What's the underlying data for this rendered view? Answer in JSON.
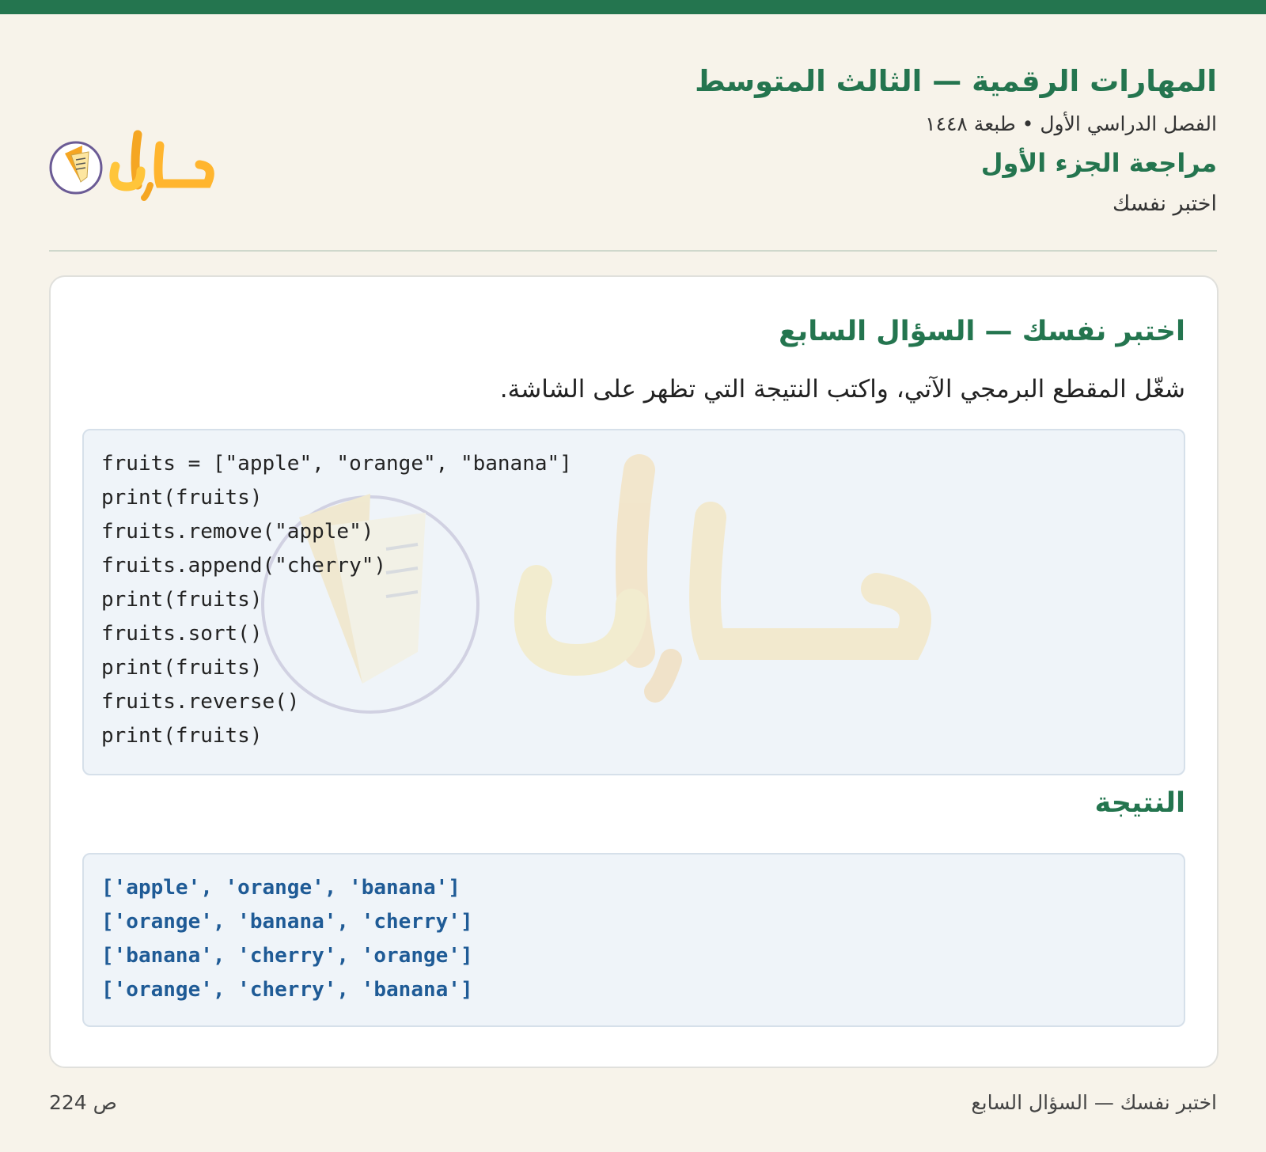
{
  "header": {
    "title": "المهارات الرقمية — الثالث المتوسط",
    "subtitle": "الفصل الدراسي الأول • طبعة ١٤٤٨",
    "section_title": "مراجعة الجزء الأول",
    "section_sub": "اختبر نفسك"
  },
  "logo": {
    "icon": "hulul-logo",
    "colors": {
      "orange": "#f5a623",
      "yellow": "#ffd23f",
      "ring": "#6b5b95"
    }
  },
  "card": {
    "title": "اختبر نفسك — السؤال السابع",
    "instruction": "شغّل المقطع البرمجي الآتي، واكتب النتيجة التي تظهر على الشاشة.",
    "code_lines": [
      "fruits = [\"apple\", \"orange\", \"banana\"]",
      "print(fruits)",
      "fruits.remove(\"apple\")",
      "fruits.append(\"cherry\")",
      "print(fruits)",
      "fruits.sort()",
      "print(fruits)",
      "fruits.reverse()",
      "print(fruits)"
    ],
    "result_title": "النتيجة",
    "result_lines": [
      "['apple', 'orange', 'banana']",
      "['orange', 'banana', 'cherry']",
      "['banana', 'cherry', 'orange']",
      "['orange', 'cherry', 'banana']"
    ]
  },
  "footer": {
    "left": "ص 224",
    "right": "اختبر نفسك — السؤال السابع"
  },
  "colors": {
    "accent": "#24754f",
    "background": "#f7f3ea",
    "code_bg": "#eff4f9",
    "result_text": "#1f5b96"
  }
}
